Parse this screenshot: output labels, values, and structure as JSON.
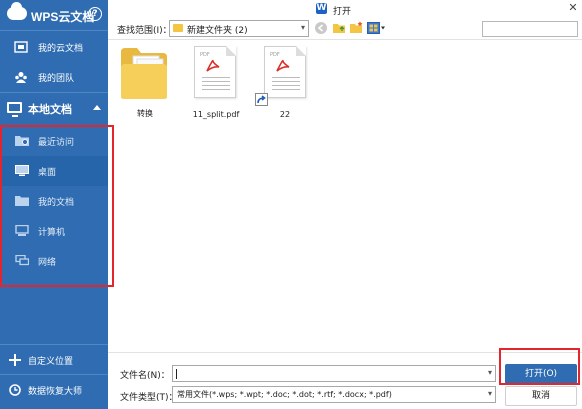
{
  "sidebar": {
    "app_title": "WPS云文档",
    "help_label": "?",
    "cloud_items": [
      {
        "label": "我的云文档",
        "icon": "cloud-doc-icon"
      },
      {
        "label": "我的团队",
        "icon": "team-icon"
      }
    ],
    "local_section": {
      "label": "本地文档",
      "icon": "monitor-icon"
    },
    "local_items": [
      {
        "label": "最近访问",
        "icon": "recent-folder-icon"
      },
      {
        "label": "桌面",
        "icon": "desktop-icon"
      },
      {
        "label": "我的文档",
        "icon": "folder-icon"
      },
      {
        "label": "计算机",
        "icon": "computer-icon"
      },
      {
        "label": "网络",
        "icon": "network-icon"
      }
    ],
    "selected_local_item": "桌面",
    "bottom_items": [
      {
        "label": "自定义位置",
        "icon": "plus-icon"
      },
      {
        "label": "数据恢复大师",
        "icon": "recovery-icon"
      }
    ]
  },
  "titlebar": {
    "title": "打开",
    "logo_letter": "W",
    "close_label": "✕"
  },
  "toolbar": {
    "lookin_label": "查找范围(I)：",
    "current_folder": "新建文件夹 (2)",
    "dropdown_arrow": "▾",
    "search_placeholder": ""
  },
  "files": [
    {
      "name": "转换",
      "type": "folder"
    },
    {
      "name": "11_split.pdf",
      "type": "pdf"
    },
    {
      "name": "22",
      "type": "pdf-shortcut"
    }
  ],
  "pdf_icon_text": "PDF",
  "bottom": {
    "filename_label": "文件名(N)：",
    "filename_value": "",
    "filetype_label": "文件类型(T)：",
    "filetype_value": "常用文件(*.wps; *.wpt; *.doc; *.dot; *.rtf; *.docx; *.pdf)",
    "open_button": "打开(O)",
    "cancel_button": "取消",
    "dropdown_arrow": "▾"
  },
  "colors": {
    "sidebar_bg": "#2f6cb1",
    "selected_bg": "#2765aa",
    "accent": "#2f6cb1",
    "highlight_box": "#e3262e"
  }
}
